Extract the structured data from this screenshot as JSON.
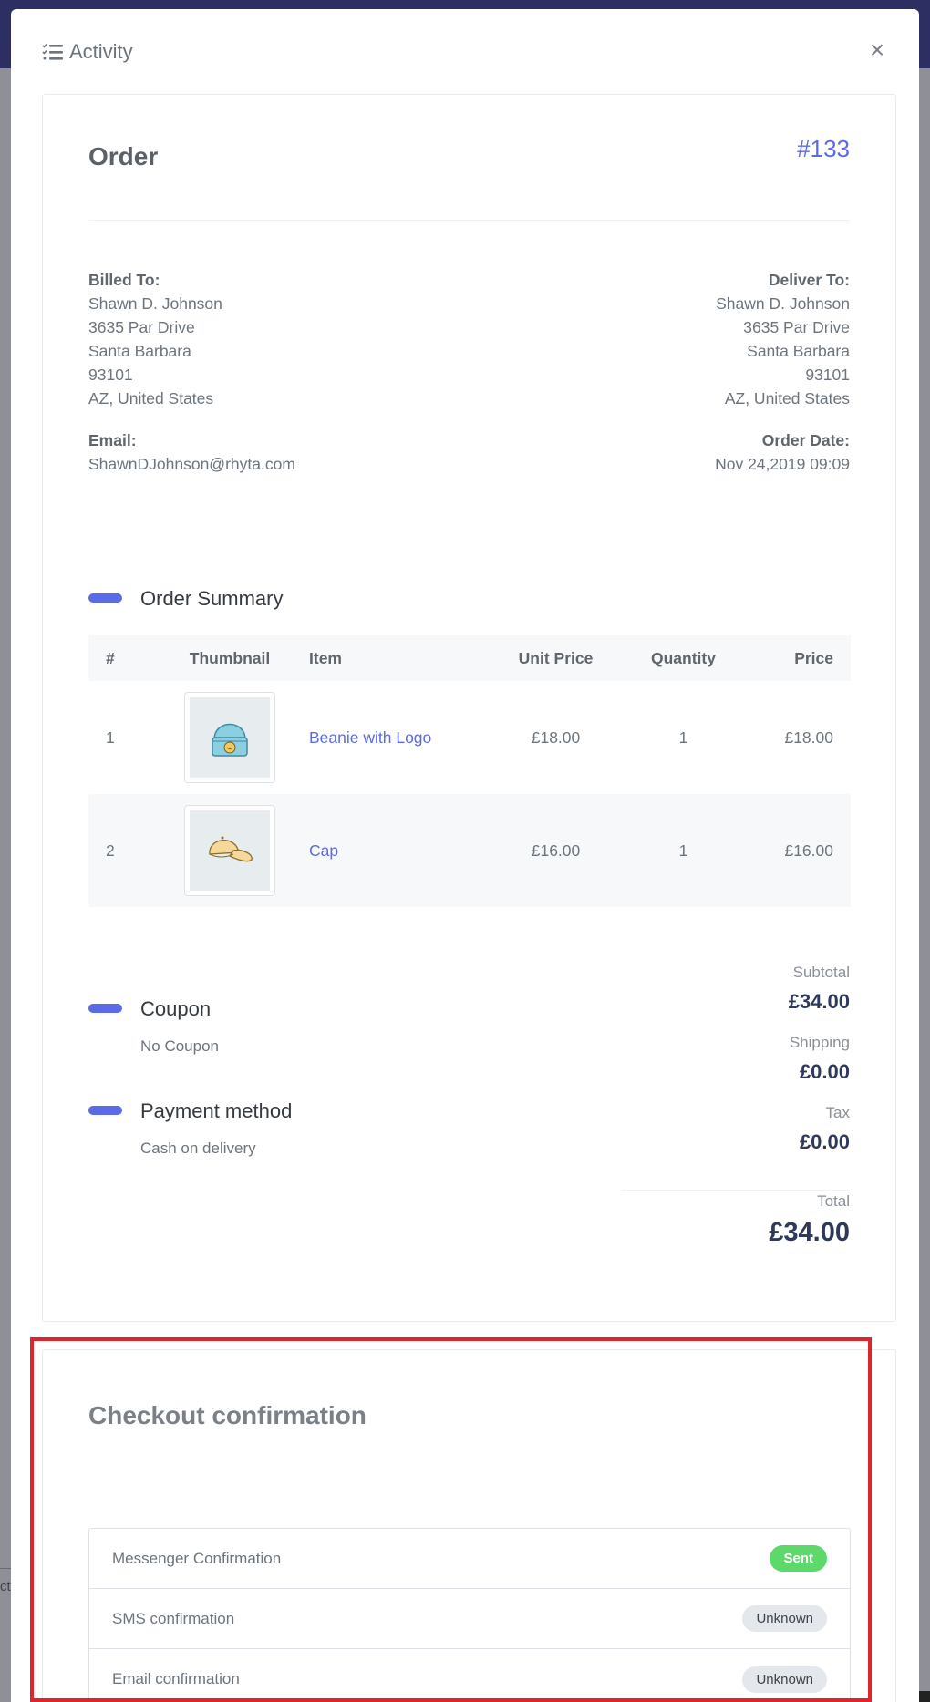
{
  "modal": {
    "title": "Activity",
    "icon": "list-check-icon",
    "close_label": "×"
  },
  "order": {
    "title": "Order",
    "number": "#133",
    "billed_to": {
      "label": "Billed To:",
      "name": "Shawn D. Johnson",
      "street": "3635 Par Drive",
      "city": "Santa Barbara",
      "zip": "93101",
      "region": "AZ, United States"
    },
    "deliver_to": {
      "label": "Deliver To:",
      "name": "Shawn D. Johnson",
      "street": "3635 Par Drive",
      "city": "Santa Barbara",
      "zip": "93101",
      "region": "AZ, United States"
    },
    "email": {
      "label": "Email:",
      "value": "ShawnDJohnson@rhyta.com"
    },
    "order_date": {
      "label": "Order Date:",
      "value": "Nov 24,2019 09:09"
    }
  },
  "summary": {
    "heading": "Order Summary",
    "columns": [
      "#",
      "Thumbnail",
      "Item",
      "Unit Price",
      "Quantity",
      "Price"
    ],
    "rows": [
      {
        "num": "1",
        "item": "Beanie with Logo",
        "unit_price": "£18.00",
        "quantity": "1",
        "price": "£18.00",
        "thumb": "beanie-image"
      },
      {
        "num": "2",
        "item": "Cap",
        "unit_price": "£16.00",
        "quantity": "1",
        "price": "£16.00",
        "thumb": "cap-image"
      }
    ]
  },
  "coupon": {
    "heading": "Coupon",
    "value": "No Coupon"
  },
  "payment": {
    "heading": "Payment method",
    "value": "Cash on delivery"
  },
  "totals": {
    "subtotal_label": "Subtotal",
    "subtotal": "£34.00",
    "shipping_label": "Shipping",
    "shipping": "£0.00",
    "tax_label": "Tax",
    "tax": "£0.00",
    "total_label": "Total",
    "total": "£34.00"
  },
  "checkout": {
    "title": "Checkout confirmation",
    "rows": [
      {
        "label": "Messenger Confirmation",
        "status": "Sent"
      },
      {
        "label": "SMS confirmation",
        "status": "Unknown"
      },
      {
        "label": "Email confirmation",
        "status": "Unknown"
      }
    ]
  },
  "colors": {
    "accent": "#5b6be8",
    "sent_badge": "#5cd96a",
    "unknown_badge": "#e4e8ec",
    "highlight": "#e0242b"
  }
}
